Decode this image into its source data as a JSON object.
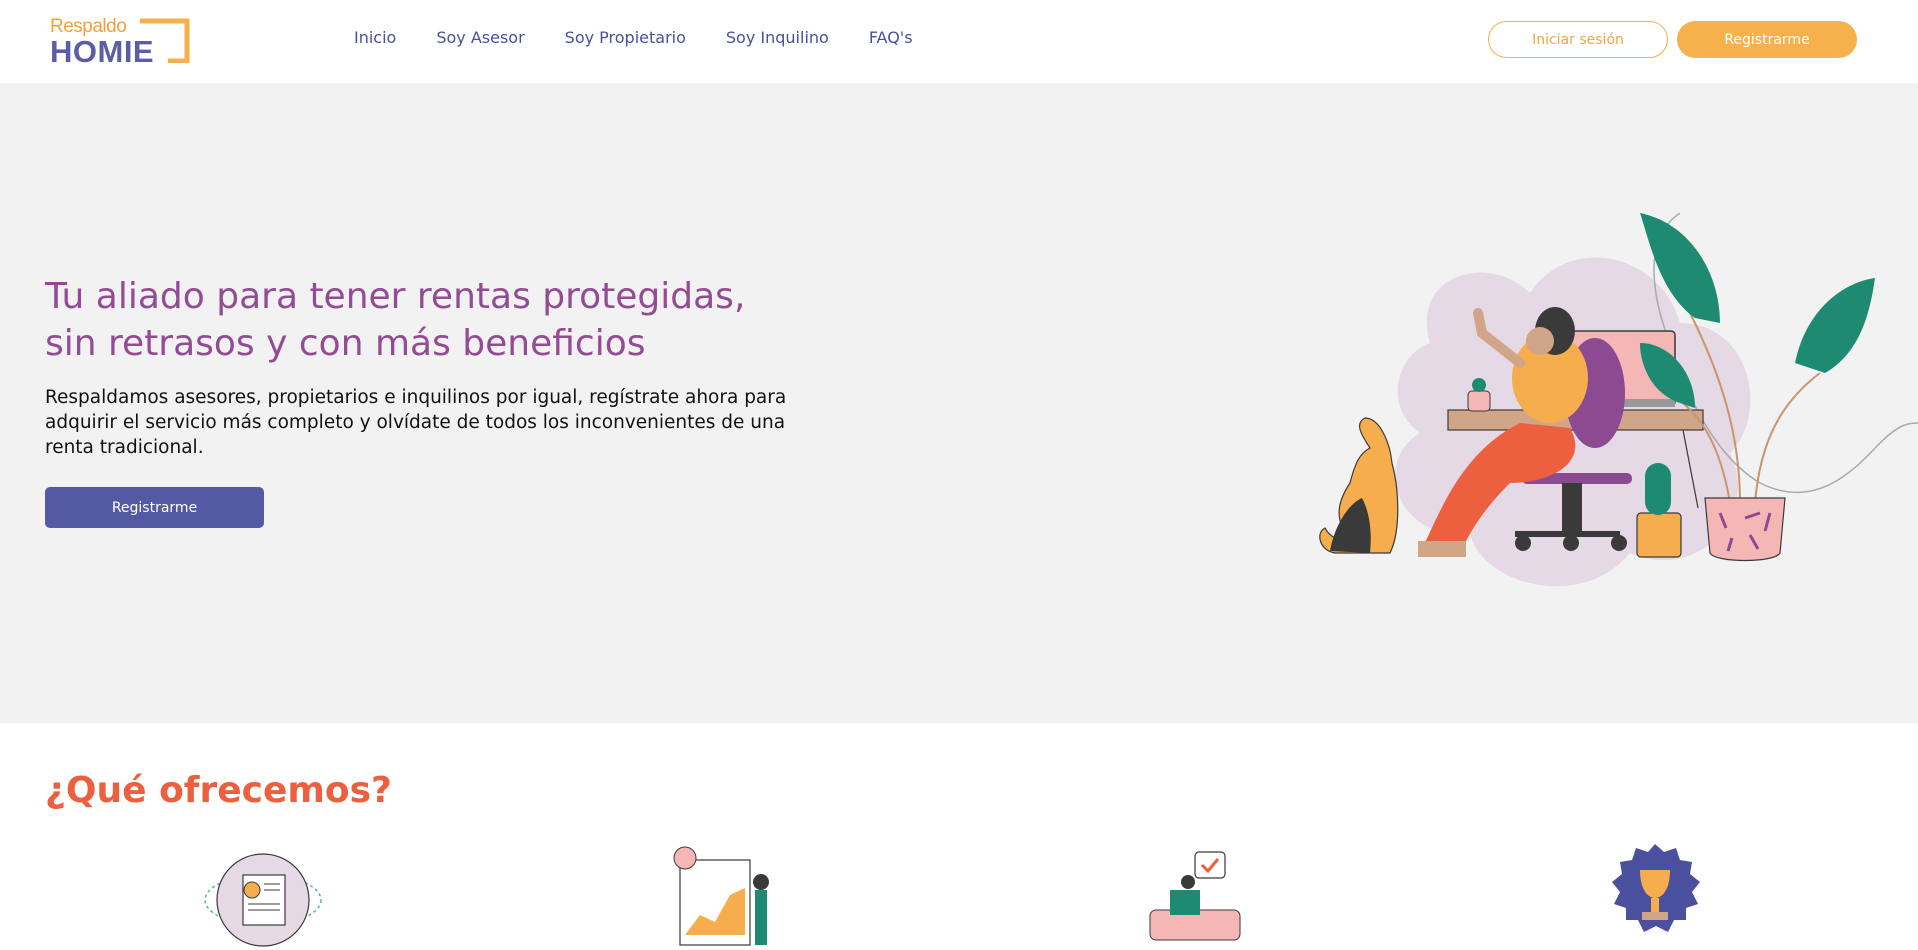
{
  "logo": {
    "top": "Respaldo",
    "main": "HOMIE"
  },
  "nav": {
    "items": [
      "Inicio",
      "Soy Asesor",
      "Soy Propietario",
      "Soy Inquilino",
      "FAQ's"
    ]
  },
  "header": {
    "login_label": "Iniciar sesión",
    "register_label": "Registrarme"
  },
  "hero": {
    "title_line1": "Tu aliado para tener rentas protegidas,",
    "title_line2": "sin retrasos y con más beneficios",
    "description": "Respaldamos asesores, propietarios e inquilinos por igual, regístrate ahora para adquirir el servicio más completo y olvídate de todos los inconvenientes de una renta tradicional.",
    "cta_label": "Registrarme"
  },
  "offer": {
    "title": "¿Qué ofrecemos?"
  },
  "colors": {
    "brand_purple": "#5b5ea6",
    "brand_orange": "#f6b14c",
    "title_magenta": "#944b95",
    "accent_red": "#ec5f3f"
  },
  "icons": [
    "logo-bracket-icon",
    "hero-illustration",
    "document-coin-icon",
    "growth-chart-icon",
    "relax-checkmark-icon",
    "trophy-badge-icon"
  ]
}
